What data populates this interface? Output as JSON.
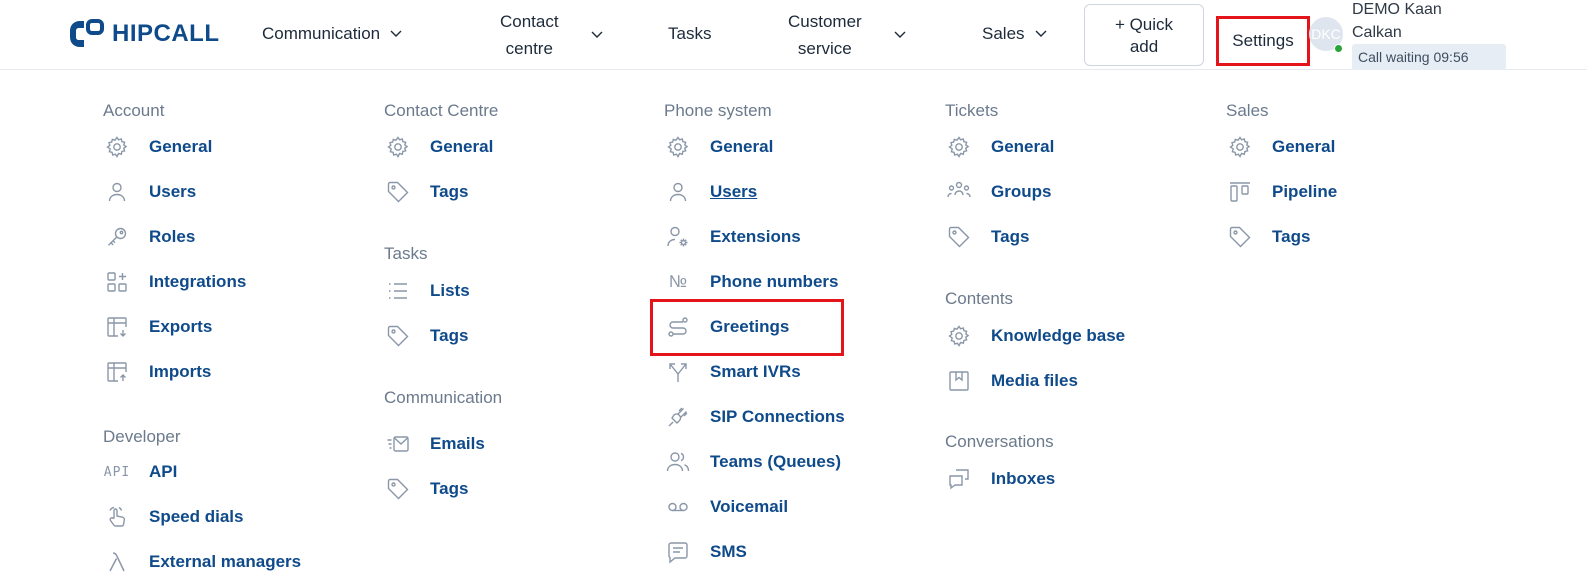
{
  "header": {
    "brand": "HIPCALL",
    "nav": {
      "communication": "Communication",
      "contact_centre_1": "Contact",
      "contact_centre_2": "centre",
      "tasks": "Tasks",
      "customer_service_1": "Customer",
      "customer_service_2": "service",
      "sales": "Sales"
    },
    "quick_add_1": "+ Quick",
    "quick_add_2": "add",
    "settings": "Settings",
    "avatar_initials": "DKC",
    "user_name": "DEMO Kaan Calkan",
    "call_waiting": "Call waiting 09:56"
  },
  "menu": {
    "account": {
      "heading": "Account",
      "items": [
        {
          "label": "General",
          "icon": "gear-icon"
        },
        {
          "label": "Users",
          "icon": "user-icon"
        },
        {
          "label": "Roles",
          "icon": "key-icon"
        },
        {
          "label": "Integrations",
          "icon": "integrations-icon"
        },
        {
          "label": "Exports",
          "icon": "export-table-icon"
        },
        {
          "label": "Imports",
          "icon": "import-table-icon"
        }
      ]
    },
    "developer": {
      "heading": "Developer",
      "items": [
        {
          "label": "API",
          "icon": "api-icon",
          "glyph": "API"
        },
        {
          "label": "Speed dials",
          "icon": "hand-pointer-icon"
        },
        {
          "label": "External managers",
          "icon": "lambda-icon"
        }
      ]
    },
    "contact_centre": {
      "heading": "Contact Centre",
      "items": [
        {
          "label": "General",
          "icon": "gear-icon"
        },
        {
          "label": "Tags",
          "icon": "tag-icon"
        }
      ]
    },
    "tasks": {
      "heading": "Tasks",
      "items": [
        {
          "label": "Lists",
          "icon": "list-icon"
        },
        {
          "label": "Tags",
          "icon": "tag-icon"
        }
      ]
    },
    "communication": {
      "heading": "Communication",
      "items": [
        {
          "label": "Emails",
          "icon": "email-icon"
        },
        {
          "label": "Tags",
          "icon": "tag-icon"
        }
      ]
    },
    "phone_system": {
      "heading": "Phone system",
      "items": [
        {
          "label": "General",
          "icon": "gear-icon"
        },
        {
          "label": "Users",
          "icon": "user-icon"
        },
        {
          "label": "Extensions",
          "icon": "user-gear-icon"
        },
        {
          "label": "Phone numbers",
          "icon": "numero-icon",
          "glyph": "№"
        },
        {
          "label": "Greetings",
          "icon": "route-icon"
        },
        {
          "label": "Smart IVRs",
          "icon": "split-arrow-icon"
        },
        {
          "label": "SIP Connections",
          "icon": "plug-icon"
        },
        {
          "label": "Teams (Queues)",
          "icon": "team-icon"
        },
        {
          "label": "Voicemail",
          "icon": "voicemail-icon"
        },
        {
          "label": "SMS",
          "icon": "message-icon"
        }
      ]
    },
    "tickets": {
      "heading": "Tickets",
      "items": [
        {
          "label": "General",
          "icon": "gear-icon"
        },
        {
          "label": "Groups",
          "icon": "group-icon"
        },
        {
          "label": "Tags",
          "icon": "tag-icon"
        }
      ]
    },
    "contents": {
      "heading": "Contents",
      "items": [
        {
          "label": "Knowledge base",
          "icon": "gear-icon"
        },
        {
          "label": "Media files",
          "icon": "bookmark-icon"
        }
      ]
    },
    "conversations": {
      "heading": "Conversations",
      "items": [
        {
          "label": "Inboxes",
          "icon": "chat-bubbles-icon"
        }
      ]
    },
    "sales": {
      "heading": "Sales",
      "items": [
        {
          "label": "General",
          "icon": "gear-icon"
        },
        {
          "label": "Pipeline",
          "icon": "pipeline-icon"
        },
        {
          "label": "Tags",
          "icon": "tag-icon"
        }
      ]
    }
  },
  "colors": {
    "link": "#0f4a8a",
    "heading": "#6b7a8c",
    "highlight": "#e3151a",
    "online": "#29a43a"
  }
}
